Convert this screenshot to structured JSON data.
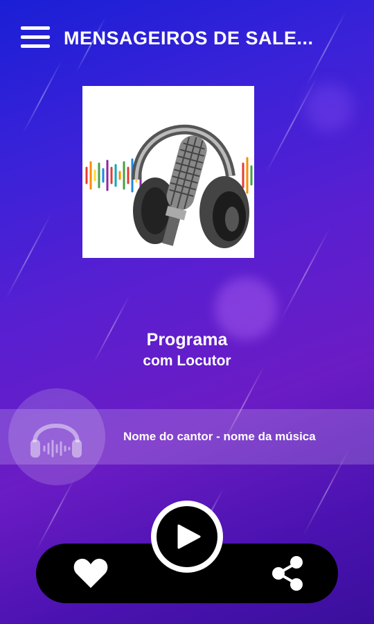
{
  "header": {
    "title": "MENSAGEIROS DE SALE...",
    "menu_icon": "hamburger-menu-icon"
  },
  "cover": {
    "icon": "studio-headphones-microphone-artwork"
  },
  "program": {
    "name": "Programa",
    "host": "com Locutor"
  },
  "now_playing": {
    "icon": "headphones-waveform-icon",
    "text": "Nome do cantor - nome da música"
  },
  "controls": {
    "favorite_icon": "heart-icon",
    "play_icon": "play-icon",
    "share_icon": "share-icon"
  },
  "colors": {
    "background_start": "#1a1fd6",
    "background_end": "#4a12b0",
    "controls_bar": "#000000",
    "text": "#ffffff"
  }
}
